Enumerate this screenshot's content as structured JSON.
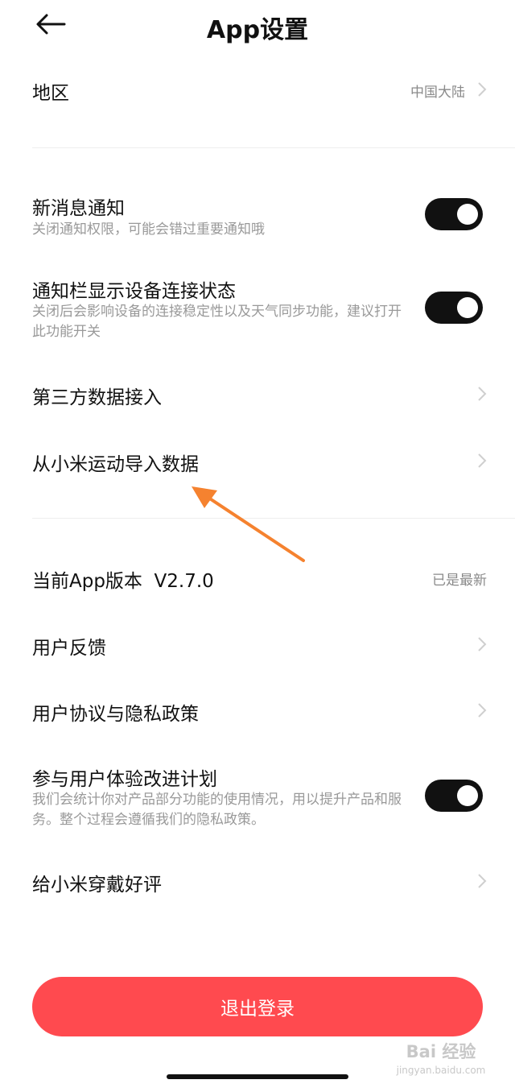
{
  "header": {
    "title": "App设置",
    "back_icon": "back-arrow-icon"
  },
  "region": {
    "label": "地区",
    "value": "中国大陆"
  },
  "notifications": {
    "label": "新消息通知",
    "desc": "关闭通知权限，可能会错过重要通知哦",
    "enabled": true
  },
  "status_bar": {
    "label": "通知栏显示设备连接状态",
    "desc": "关闭后会影响设备的连接稳定性以及天气同步功能，建议打开此功能开关",
    "enabled": true
  },
  "third_party": {
    "label": "第三方数据接入"
  },
  "import_mi": {
    "label": "从小米运动导入数据"
  },
  "version": {
    "label": "当前App版本  V2.7.0",
    "status": "已是最新"
  },
  "feedback": {
    "label": "用户反馈"
  },
  "agreement": {
    "label": "用户协议与隐私政策"
  },
  "ux_program": {
    "label": "参与用户体验改进计划",
    "desc": "我们会统计你对产品部分功能的使用情况，用以提升产品和服务。整个过程会遵循我们的隐私政策。",
    "enabled": true
  },
  "rate": {
    "label": "给小米穿戴好评"
  },
  "logout": {
    "label": "退出登录"
  },
  "watermark": {
    "logo": "Bai 经验",
    "site": "jingyan.baidu.com"
  },
  "colors": {
    "toggle_on": "#111111",
    "logout_bg": "#ff4a4f",
    "annotation_arrow": "#f5822f"
  }
}
